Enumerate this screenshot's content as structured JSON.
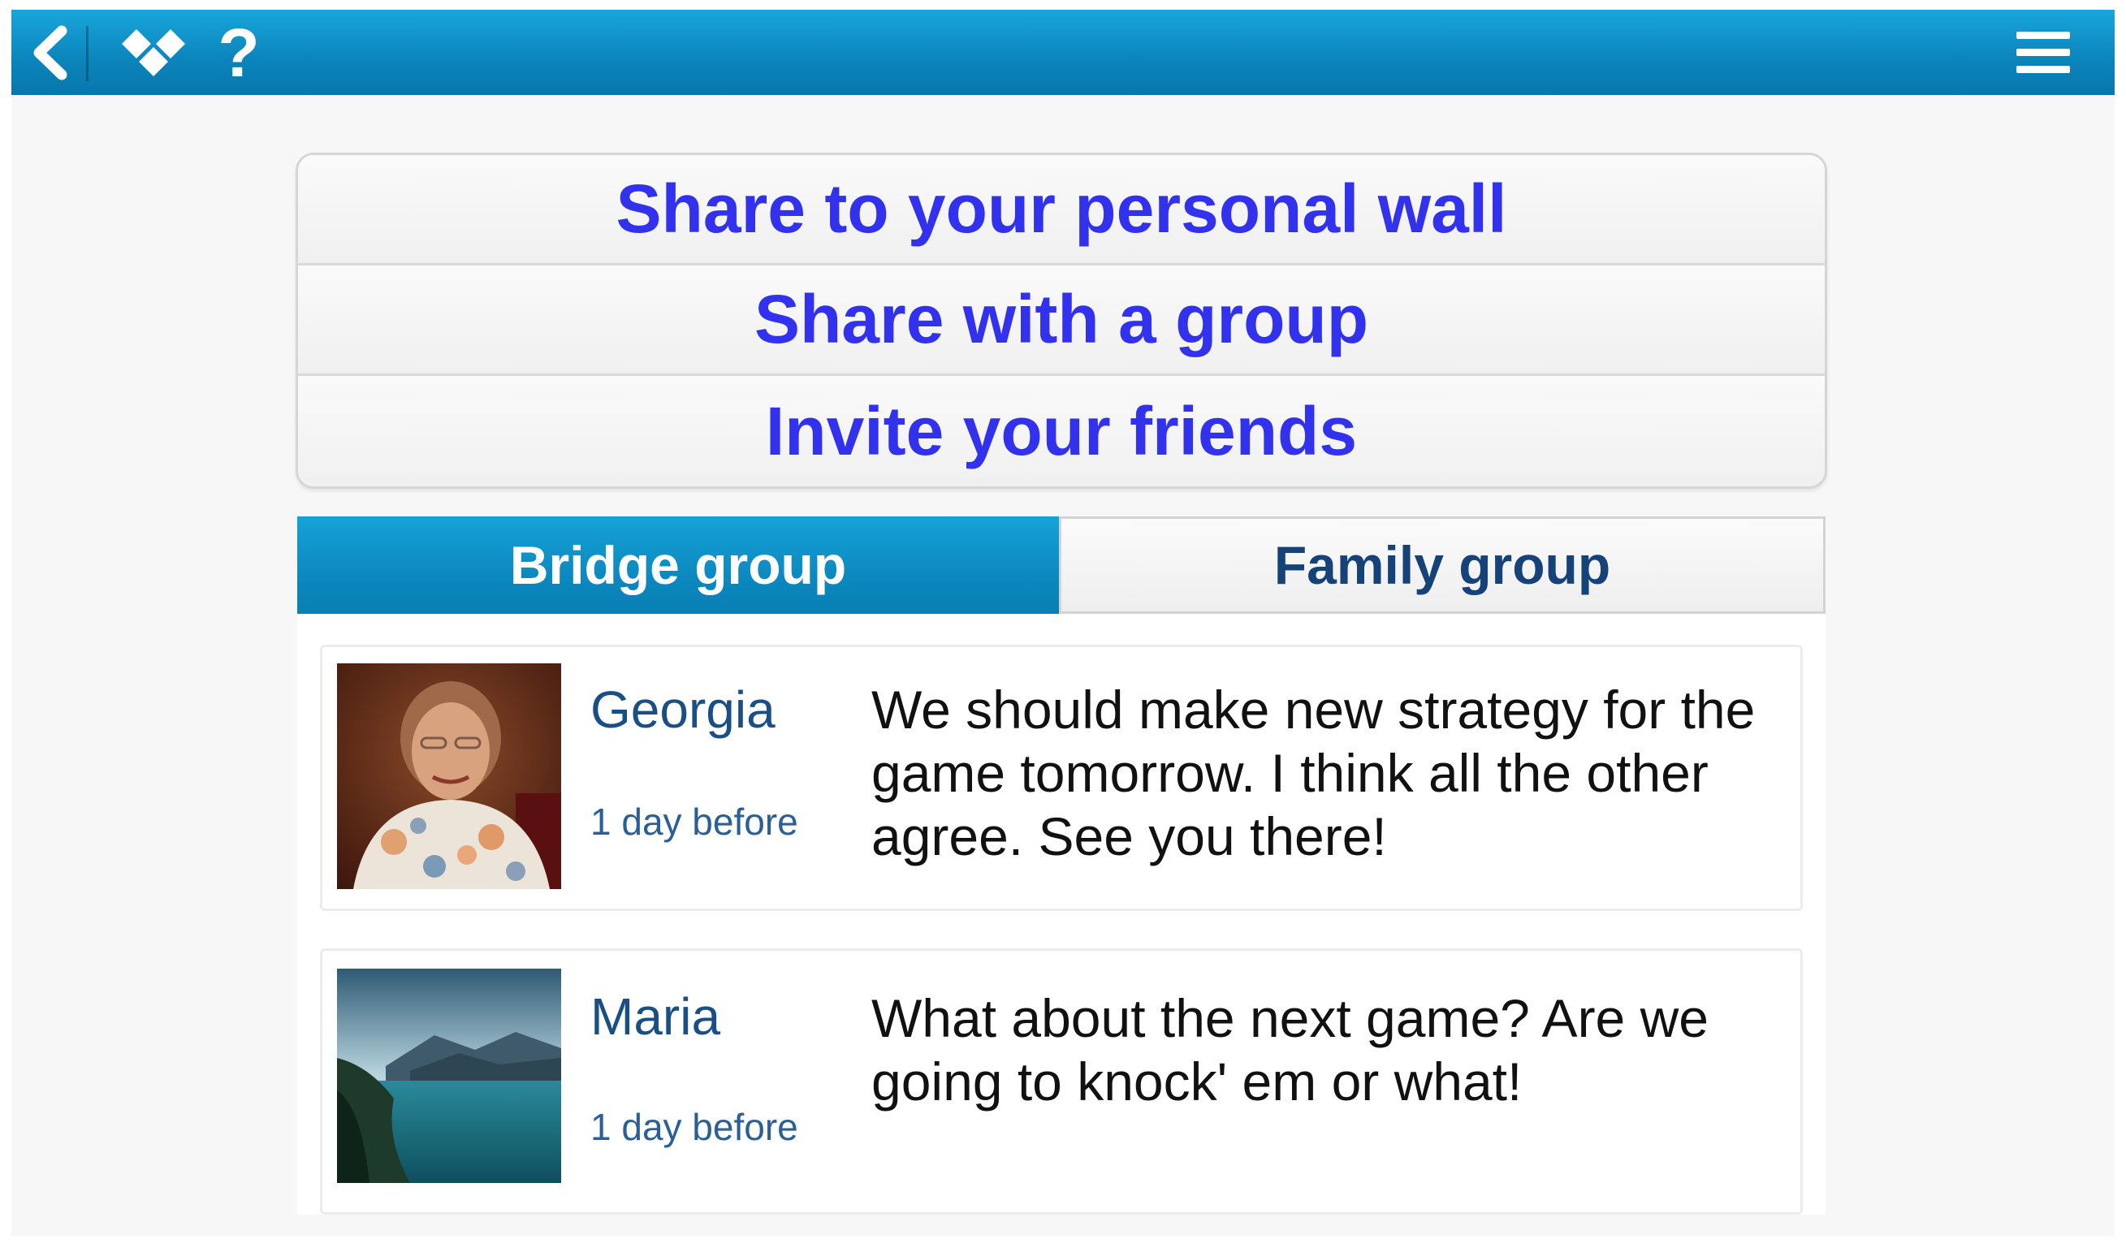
{
  "topbar": {
    "back_icon": "chevron-left-icon",
    "logo_icon": "diamond-logo-icon",
    "help_icon": "question-mark-icon",
    "menu_icon": "hamburger-menu-icon",
    "help_label": "?"
  },
  "share": {
    "items": [
      {
        "label": "Share to your personal wall"
      },
      {
        "label": "Share with a group"
      },
      {
        "label": "Invite your friends"
      }
    ]
  },
  "tabs": [
    {
      "label": "Bridge group",
      "active": true
    },
    {
      "label": "Family group",
      "active": false
    }
  ],
  "posts": [
    {
      "author": "Georgia",
      "time": "1 day before",
      "message": "We should make new strategy for the game tomorrow. I think all the other agree. See you there!",
      "avatar": "woman-portrait-photo"
    },
    {
      "author": "Maria",
      "time": "1 day before",
      "message": "What about the next game? Are we going to knock' em or what!",
      "avatar": "lake-mountain-photo"
    }
  ],
  "colors": {
    "accent": "#0a86bc",
    "link_blue": "#3232ee",
    "dark_blue": "#16427a"
  }
}
